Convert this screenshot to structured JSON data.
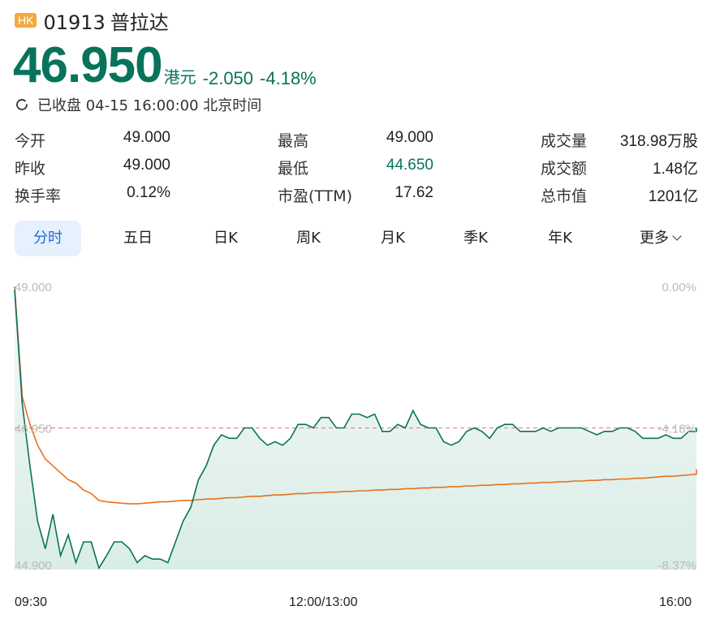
{
  "header": {
    "market_badge": "HK",
    "code": "01913",
    "name": "普拉达"
  },
  "quote": {
    "price": "46.950",
    "unit": "港元",
    "change": "-2.050",
    "change_pct": "-4.18%",
    "status": "已收盘 04-15 16:00:00 北京时间",
    "color_down": "#08735b"
  },
  "stats": [
    [
      {
        "label": "今开",
        "value": "49.000"
      },
      {
        "label": "最高",
        "value": "49.000"
      },
      {
        "label": "成交量",
        "value": "318.98万股"
      }
    ],
    [
      {
        "label": "昨收",
        "value": "49.000"
      },
      {
        "label": "最低",
        "value": "44.650",
        "green": true
      },
      {
        "label": "成交额",
        "value": "1.48亿"
      }
    ],
    [
      {
        "label": "换手率",
        "value": "0.12%"
      },
      {
        "label": "市盈(TTM)",
        "value": "17.62"
      },
      {
        "label": "总市值",
        "value": "1201亿"
      }
    ]
  ],
  "tabs": [
    "分时",
    "五日",
    "日K",
    "周K",
    "月K",
    "季K",
    "年K",
    "更多"
  ],
  "active_tab": "分时",
  "chart_data": {
    "type": "line",
    "y_left_ticks": [
      "49.000",
      "46.950",
      "44.900"
    ],
    "y_right_ticks": [
      "0.00%",
      "-4.18%",
      "-8.37%"
    ],
    "x_ticks": [
      "09:30",
      "12:00/13:00",
      "16:00"
    ],
    "ylim": [
      44.9,
      49.0
    ],
    "reference_price": 46.95,
    "session_points": 90,
    "series": [
      {
        "color": "#08735b",
        "values": [
          48.95,
          47.3,
          46.4,
          45.6,
          45.2,
          45.7,
          45.1,
          45.4,
          45.0,
          45.3,
          45.3,
          44.92,
          45.1,
          45.3,
          45.3,
          45.2,
          45.0,
          45.1,
          45.05,
          45.05,
          45.0,
          45.3,
          45.6,
          45.8,
          46.2,
          46.4,
          46.7,
          46.85,
          46.8,
          46.8,
          46.95,
          46.95,
          46.8,
          46.7,
          46.75,
          46.7,
          46.8,
          47.0,
          47.0,
          46.95,
          47.1,
          47.1,
          46.95,
          46.95,
          47.15,
          47.15,
          47.1,
          47.15,
          46.9,
          46.9,
          47.0,
          46.95,
          47.2,
          47.0,
          46.95,
          46.95,
          46.75,
          46.7,
          46.75,
          46.9,
          46.95,
          46.9,
          46.8,
          46.95,
          47.0,
          47.0,
          46.9,
          46.9,
          46.9,
          46.95,
          46.9,
          46.95,
          46.95,
          46.95,
          46.95,
          46.9,
          46.85,
          46.9,
          46.9,
          46.95,
          46.95,
          46.9,
          46.8,
          46.8,
          46.8,
          46.85,
          46.8,
          46.8,
          46.9,
          46.9
        ],
        "last_value": 46.95
      },
      {
        "color": "#e8701e",
        "values": [
          49.0,
          47.4,
          47.0,
          46.7,
          46.5,
          46.4,
          46.3,
          46.2,
          46.15,
          46.05,
          46.0,
          45.9,
          45.88,
          45.87,
          45.86,
          45.85,
          45.85,
          45.86,
          45.87,
          45.88,
          45.88,
          45.89,
          45.9,
          45.9,
          45.91,
          45.92,
          45.92,
          45.93,
          45.94,
          45.94,
          45.95,
          45.96,
          45.96,
          45.97,
          45.98,
          45.98,
          45.99,
          46.0,
          46.0,
          46.01,
          46.01,
          46.02,
          46.02,
          46.03,
          46.03,
          46.04,
          46.04,
          46.05,
          46.05,
          46.06,
          46.06,
          46.07,
          46.07,
          46.08,
          46.08,
          46.09,
          46.09,
          46.1,
          46.1,
          46.11,
          46.11,
          46.12,
          46.12,
          46.13,
          46.13,
          46.14,
          46.14,
          46.15,
          46.15,
          46.16,
          46.16,
          46.17,
          46.17,
          46.18,
          46.18,
          46.19,
          46.19,
          46.2,
          46.2,
          46.21,
          46.21,
          46.22,
          46.22,
          46.23,
          46.24,
          46.25,
          46.25,
          46.26,
          46.27,
          46.28
        ],
        "last_value": 46.35
      }
    ],
    "grid": false
  }
}
